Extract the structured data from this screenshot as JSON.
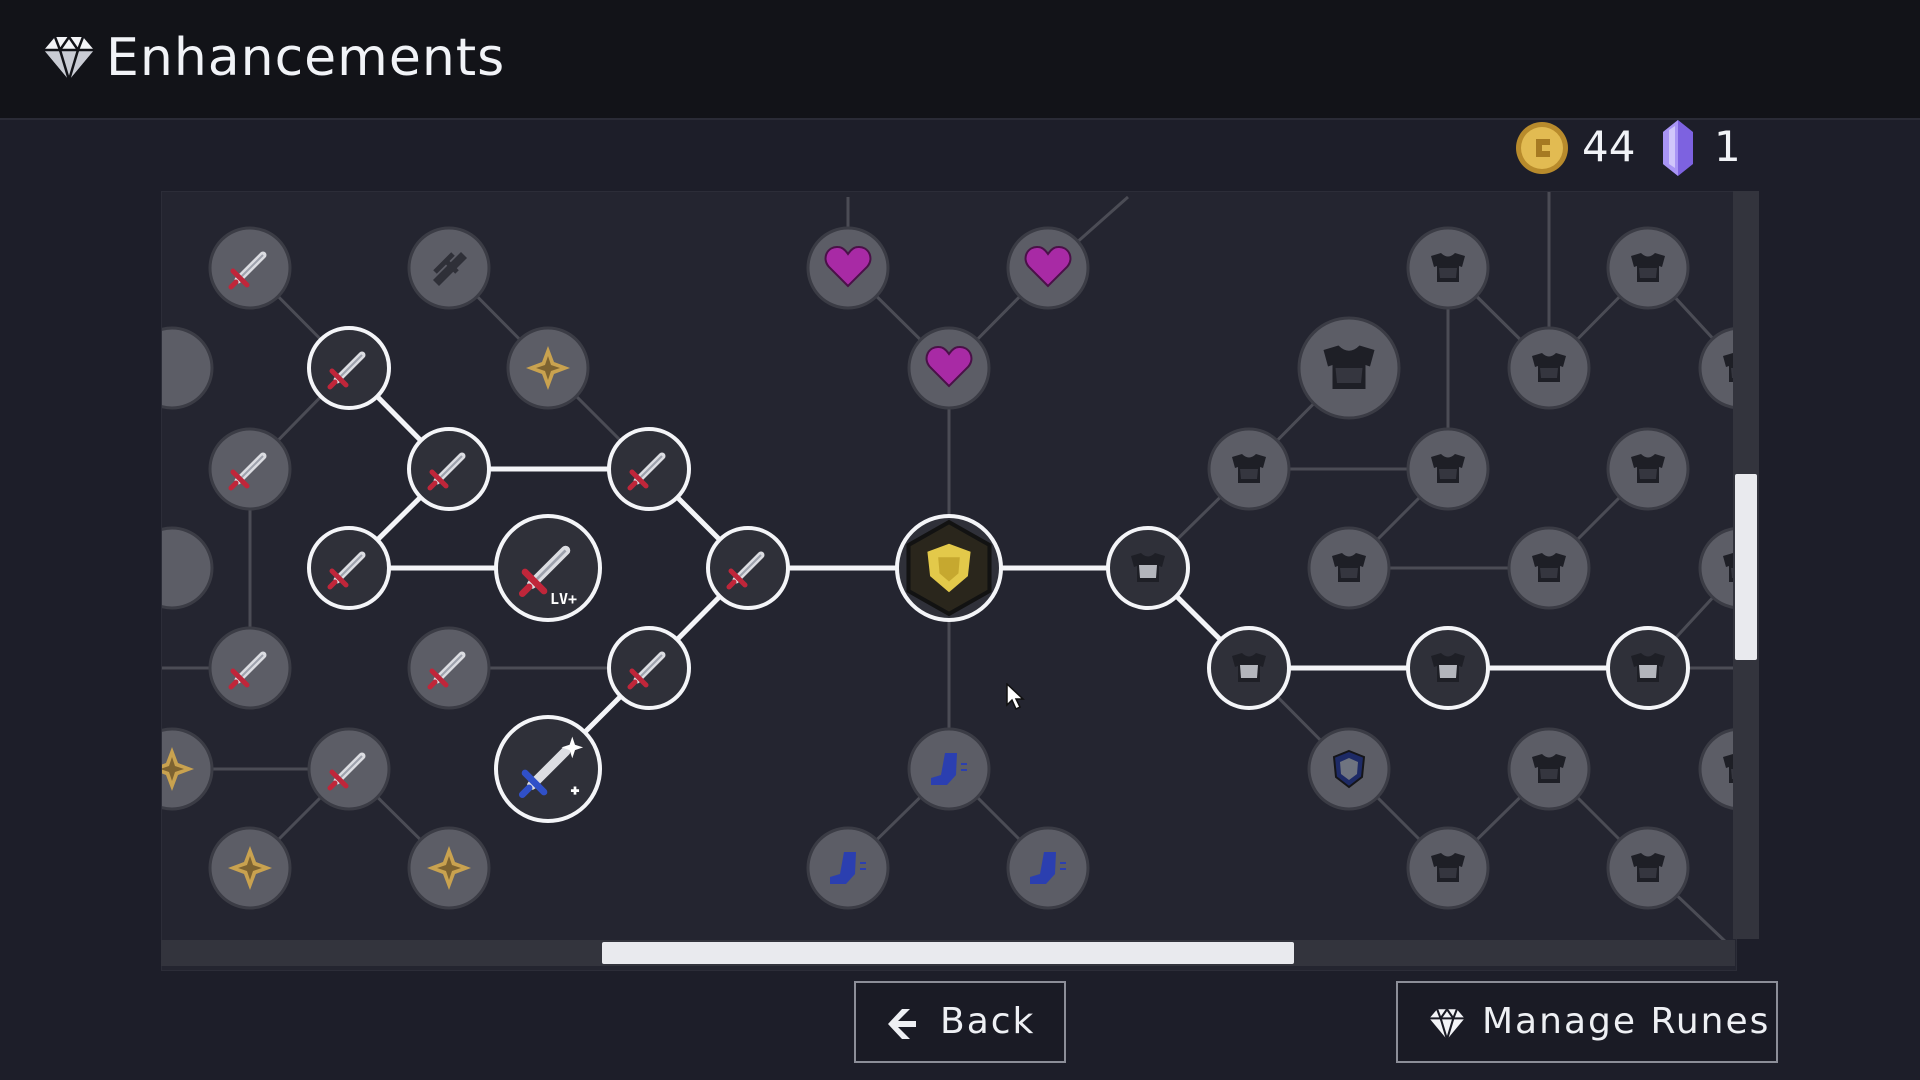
{
  "header": {
    "title": "Enhancements",
    "title_icon": "diamond-icon"
  },
  "currency": {
    "coins": {
      "value": "44",
      "icon": "gold-coin-icon",
      "color": "#d9b24c"
    },
    "crystals": {
      "value": "1",
      "icon": "purple-crystal-icon",
      "color": "#8f73ef"
    }
  },
  "skill_tree": {
    "node_types": [
      "sword",
      "dagger",
      "star-rune",
      "heart",
      "armor",
      "boot",
      "shield",
      "core-shield"
    ],
    "center_node": "core-shield",
    "level_up_label": "LV+",
    "unlocked_color": "#ffffff",
    "locked_color": "#5c5d66"
  },
  "buttons": {
    "back": {
      "label": "Back",
      "icon": "back-arrow-icon"
    },
    "manage_runes": {
      "label": "Manage Runes",
      "icon": "diamond-icon"
    }
  }
}
